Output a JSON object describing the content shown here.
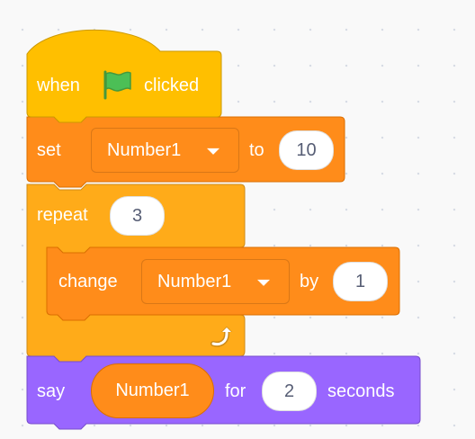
{
  "hat": {
    "word1": "when",
    "flag_icon": "green-flag-icon",
    "word2": "clicked"
  },
  "set_block": {
    "label": "set",
    "variable": "Number1",
    "to_label": "to",
    "value": "10"
  },
  "repeat_block": {
    "label": "repeat",
    "times": "3",
    "loop_icon": "loop-arrow-icon"
  },
  "change_block": {
    "label": "change",
    "variable": "Number1",
    "by_label": "by",
    "value": "1"
  },
  "say_block": {
    "label": "say",
    "reporter": "Number1",
    "for_label": "for",
    "seconds_value": "2",
    "seconds_label": "seconds"
  },
  "colors": {
    "events": "#ffbf00",
    "events_border": "#cc9900",
    "variables": "#ff8c1a",
    "variables_border": "#db6e00",
    "control": "#ffab19",
    "control_border": "#cf8b17",
    "looks": "#9966ff",
    "looks_border": "#774dcb",
    "flag": "#4cbf56"
  }
}
